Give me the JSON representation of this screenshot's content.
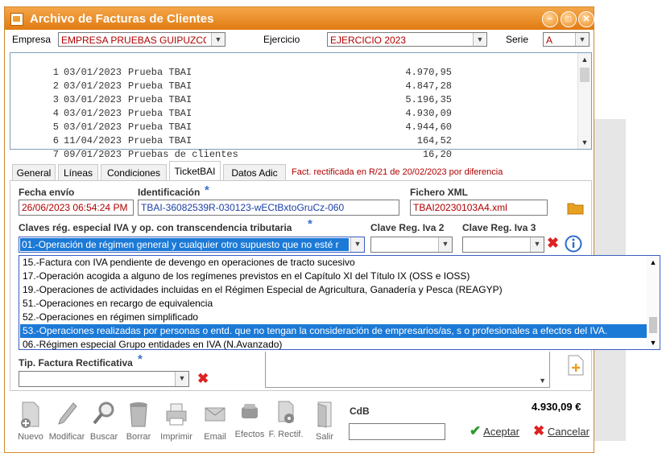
{
  "window": {
    "title": "Archivo de Facturas de Clientes",
    "buttons": [
      "−",
      "□",
      "✕"
    ]
  },
  "header": {
    "empresa_label": "Empresa",
    "empresa_value": "EMPRESA PRUEBAS GUIPUZCOA",
    "ejercicio_label": "Ejercicio",
    "ejercicio_value": "EJERCICIO 2023",
    "serie_label": "Serie",
    "serie_value": "A"
  },
  "invoices": [
    {
      "n": "1",
      "date": "03/01/2023",
      "desc": "Prueba TBAI",
      "amount": "4.970,95"
    },
    {
      "n": "2",
      "date": "03/01/2023",
      "desc": "Prueba TBAI",
      "amount": "4.847,28"
    },
    {
      "n": "3",
      "date": "03/01/2023",
      "desc": "Prueba TBAI",
      "amount": "5.196,35"
    },
    {
      "n": "4",
      "date": "03/01/2023",
      "desc": "Prueba TBAI",
      "amount": "4.930,09"
    },
    {
      "n": "5",
      "date": "03/01/2023",
      "desc": "Prueba TBAI",
      "amount": "4.944,60"
    },
    {
      "n": "6",
      "date": "11/04/2023",
      "desc": "Prueba TBAI",
      "amount": "164,52"
    },
    {
      "n": "7",
      "date": "09/01/2023",
      "desc": "Pruebas de clientes",
      "amount": "16,20"
    }
  ],
  "tabs": [
    {
      "label": "General"
    },
    {
      "label": "Líneas"
    },
    {
      "label": "Condiciones"
    },
    {
      "label": "TicketBAI"
    },
    {
      "label": "Datos Adic"
    }
  ],
  "notice": "Fact. rectificada en R/21 de 20/02/2023 por diferencia",
  "ticketbai": {
    "fecha_label": "Fecha envío",
    "fecha_value": "26/06/2023 06:54:24 PM",
    "id_label": "Identificación",
    "id_value": "TBAI-36082539R-030123-wECtBxtoGruCz-060",
    "xml_label": "Fichero XML",
    "xml_value": "TBAI20230103A4.xml",
    "claves_label": "Claves rég. especial IVA y op. con transcendencia tributaria",
    "clave_value": "01.-Operación de régimen general y cualquier otro supuesto que no esté r",
    "clave2_label": "Clave Reg. Iva 2",
    "clave3_label": "Clave Reg. Iva 3",
    "tip_label": "Tip. Factura Rectificativa"
  },
  "dropdown_options": [
    {
      "label": "15.-Factura con IVA pendiente de devengo en operaciones de tracto sucesivo"
    },
    {
      "label": "17.-Operación acogida a alguno de los regímenes previstos en el Capítulo XI del Título IX (OSS e IOSS)"
    },
    {
      "label": "19.-Operaciones de actividades incluidas en el Régimen Especial de Agricultura, Ganadería y Pesca (REAGYP)"
    },
    {
      "label": "51.-Operaciones en recargo de equivalencia"
    },
    {
      "label": "52.-Operaciones en régimen simplificado"
    },
    {
      "label": "53.-Operaciones realizadas por personas o entd. que no tengan la consideración de empresarios/as, s o profesionales a efectos del IVA."
    },
    {
      "label": "06.-Régimen especial Grupo entidades en IVA (N.Avanzado)"
    }
  ],
  "toolbar": [
    {
      "label": "Nuevo",
      "icon": "new-doc-icon"
    },
    {
      "label": "Modificar",
      "icon": "pencil-icon"
    },
    {
      "label": "Buscar",
      "icon": "magnifier-icon"
    },
    {
      "label": "Borrar",
      "icon": "trash-icon"
    },
    {
      "label": "Imprimir",
      "icon": "printer-icon"
    },
    {
      "label": "Email",
      "icon": "envelope-icon"
    },
    {
      "label": "Efectos",
      "icon": "stack-icon"
    },
    {
      "label": "F. Rectif.",
      "icon": "doc-gear-icon"
    },
    {
      "label": "Salir",
      "icon": "door-icon"
    }
  ],
  "cdb_label": "CdB",
  "total": "4.930,09 €",
  "aceptar": "Aceptar",
  "cancelar": "Cancelar",
  "colors": {
    "title_orange": "#e9871e",
    "selection_blue": "#1c7ad7",
    "field_red": "#b00000",
    "accent_blue": "#3b6fc9"
  }
}
